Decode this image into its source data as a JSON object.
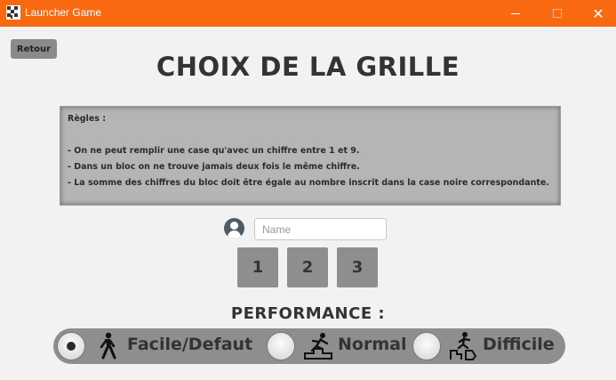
{
  "window": {
    "title": "Launcher Game",
    "controls": {
      "minimize": "—",
      "maximize": "□",
      "close": "✕"
    }
  },
  "back_button": "Retour",
  "page_title": "CHOIX DE LA GRILLE",
  "rules": {
    "heading": "Règles :",
    "lines": [
      "- On ne peut remplir une case qu'avec un chiffre entre 1 et 9.",
      "- Dans un bloc on ne trouve jamais deux fois le même chiffre.",
      "- La somme des chiffres du bloc doit être égale au nombre inscrit dans la case noire correspondante."
    ]
  },
  "name_field": {
    "value": "",
    "placeholder": "Name"
  },
  "grids": [
    "1",
    "2",
    "3"
  ],
  "performance": {
    "title": "PERFORMANCE :",
    "options": [
      {
        "label": "Facile/Defaut",
        "icon": "walking-person-icon",
        "selected": true
      },
      {
        "label": "Normal",
        "icon": "running-stairs-icon",
        "selected": false
      },
      {
        "label": "Difficile",
        "icon": "climbing-icon",
        "selected": false
      }
    ]
  },
  "colors": {
    "titlebar": "#f96a10",
    "panel": "#8e8e8e",
    "text": "#333333"
  }
}
